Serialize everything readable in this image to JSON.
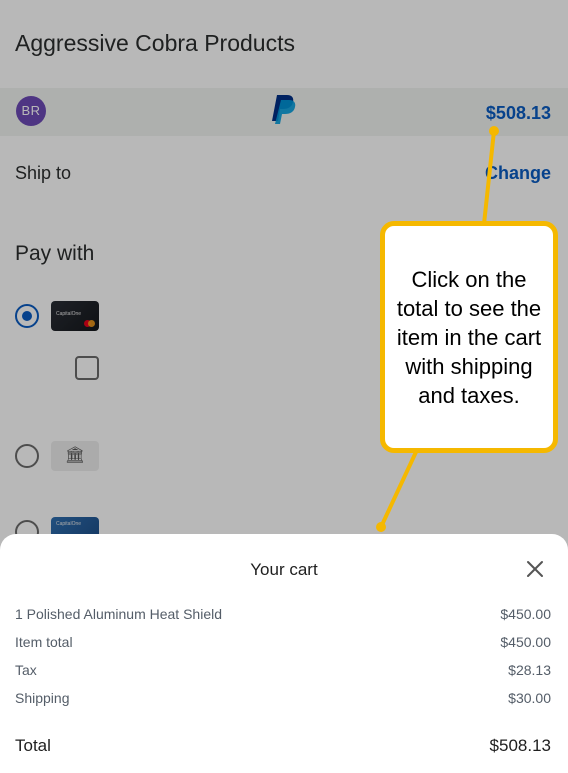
{
  "merchant": {
    "name": "Aggressive Cobra Products"
  },
  "header": {
    "avatar_initials": "BR",
    "total": "$508.13"
  },
  "shipping": {
    "label": "Ship to",
    "change_label": "Change"
  },
  "payment": {
    "heading": "Pay with",
    "card1_brand": "CapitalOne",
    "card3_brand": "CapitalOne"
  },
  "cart": {
    "title": "Your cart",
    "items": [
      {
        "label": "1 Polished Aluminum Heat Shield",
        "amount": "$450.00"
      },
      {
        "label": "Item total",
        "amount": "$450.00"
      },
      {
        "label": "Tax",
        "amount": "$28.13"
      },
      {
        "label": "Shipping",
        "amount": "$30.00"
      }
    ],
    "total_label": "Total",
    "total_amount": "$508.13"
  },
  "callout": {
    "text": "Click on the total to see the item in the cart with shipping and taxes."
  },
  "colors": {
    "accent": "#0a5cc2",
    "callout_border": "#f5b800",
    "avatar": "#6c4ab6"
  }
}
